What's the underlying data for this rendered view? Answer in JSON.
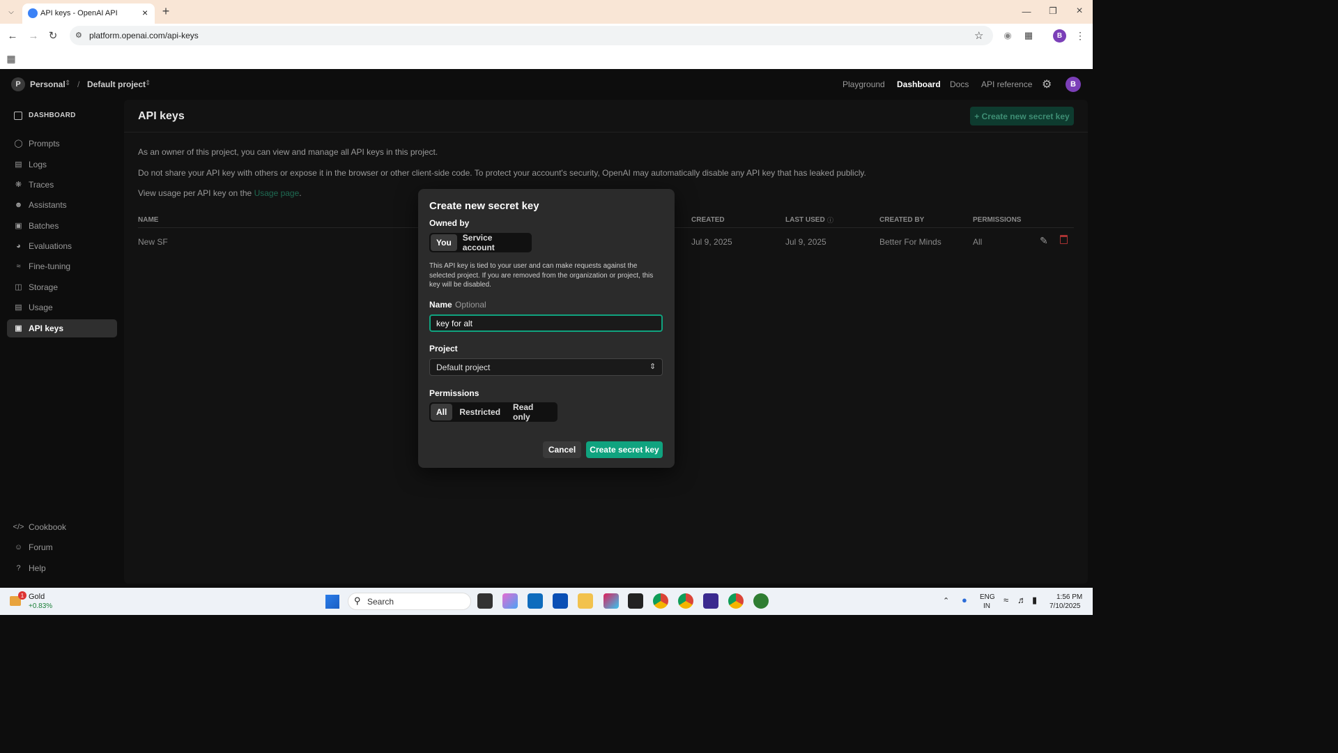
{
  "browser": {
    "tab_title": "API keys - OpenAI API",
    "url": "platform.openai.com/api-keys",
    "profile_initial": "B"
  },
  "topnav": {
    "org_initial": "P",
    "org": "Personal",
    "separator": "/",
    "project": "Default project",
    "links": [
      "Playground",
      "Dashboard",
      "Docs",
      "API reference"
    ],
    "avatar": "B"
  },
  "sidebar": {
    "section": "DASHBOARD",
    "items": [
      {
        "label": "Prompts",
        "icon": "chat-bubble-icon"
      },
      {
        "label": "Logs",
        "icon": "list-icon"
      },
      {
        "label": "Traces",
        "icon": "nodes-icon"
      },
      {
        "label": "Assistants",
        "icon": "person-icon"
      },
      {
        "label": "Batches",
        "icon": "stack-icon"
      },
      {
        "label": "Evaluations",
        "icon": "gauge-icon"
      },
      {
        "label": "Fine-tuning",
        "icon": "tune-icon"
      },
      {
        "label": "Storage",
        "icon": "database-icon"
      },
      {
        "label": "Usage",
        "icon": "chart-icon"
      },
      {
        "label": "API keys",
        "icon": "lock-icon"
      }
    ],
    "footer": [
      {
        "label": "Cookbook",
        "icon": "code-icon"
      },
      {
        "label": "Forum",
        "icon": "people-icon"
      },
      {
        "label": "Help",
        "icon": "help-icon"
      }
    ]
  },
  "page": {
    "title": "API keys",
    "create_button": "+ Create new secret key",
    "desc1": "As an owner of this project, you can view and manage all API keys in this project.",
    "desc2": "Do not share your API key with others or expose it in the browser or other client-side code. To protect your account's security, OpenAI may automatically disable any API key that has leaked publicly.",
    "desc3_prefix": "View usage per API key on the ",
    "desc3_link": "Usage page",
    "desc3_suffix": ".",
    "columns": [
      "NAME",
      "CREATED",
      "LAST USED",
      "CREATED BY",
      "PERMISSIONS"
    ],
    "rows": [
      {
        "name": "New SF",
        "created": "Jul 9, 2025",
        "last_used": "Jul 9, 2025",
        "created_by": "Better For Minds",
        "permissions": "All"
      }
    ]
  },
  "modal": {
    "title": "Create new secret key",
    "owned_by_label": "Owned by",
    "owned_by_options": [
      "You",
      "Service account"
    ],
    "owned_by_selected": "You",
    "owned_by_help": "This API key is tied to your user and can make requests against the selected project. If you are removed from the organization or project, this key will be disabled.",
    "name_label": "Name",
    "name_optional": "Optional",
    "name_value": "key for alt",
    "project_label": "Project",
    "project_value": "Default project",
    "permissions_label": "Permissions",
    "permissions_options": [
      "All",
      "Restricted",
      "Read only"
    ],
    "permissions_selected": "All",
    "cancel": "Cancel",
    "submit": "Create secret key"
  },
  "taskbar": {
    "widget_title": "Gold",
    "widget_value": "+0.83%",
    "widget_badge": "1",
    "search_placeholder": "Search",
    "lang1": "ENG",
    "lang2": "IN",
    "time": "1:56 PM",
    "date": "7/10/2025"
  },
  "colors": {
    "accent": "#10a37f",
    "danger": "#e5484d",
    "link": "#2aa37f"
  }
}
